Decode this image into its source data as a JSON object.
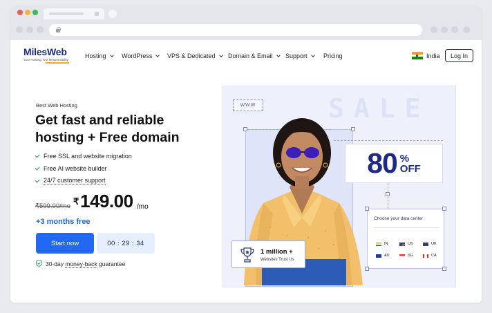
{
  "brand": {
    "name": "MilesWeb",
    "tagline": "Your Hosting, Our Responsibility.",
    "accent": "#2368f2",
    "dark": "#1c2a86"
  },
  "nav": {
    "items": [
      {
        "label": "Hosting",
        "dropdown": true
      },
      {
        "label": "WordPress",
        "dropdown": true
      },
      {
        "label": "VPS & Dedicated",
        "dropdown": true
      },
      {
        "label": "Domain & Email",
        "dropdown": true
      },
      {
        "label": "Support",
        "dropdown": true
      },
      {
        "label": "Pricing",
        "dropdown": false
      }
    ],
    "country": "India",
    "login": "Log In"
  },
  "hero": {
    "kicker": "Best Web Hosting",
    "title_line1": "Get fast and reliable",
    "title_line2": "hosting + Free domain",
    "features": [
      "Free SSL and website migration",
      "Free AI website builder",
      "24/7 customer support"
    ],
    "old_price": "₹599.00/mo",
    "currency": "₹",
    "price": "149.00",
    "per": "/mo",
    "bonus": "+3 months free",
    "cta": "Start now",
    "timer": "00 : 29 : 34",
    "guarantee_prefix": "30-day ",
    "guarantee_link": "money-back",
    "guarantee_suffix": " guarantee"
  },
  "promo": {
    "sale_text": "SALE",
    "www": "WWW",
    "discount": "80",
    "percent": "%",
    "off": "OFF",
    "datacenter_title": "Choose your data center",
    "locations": [
      "IN",
      "US",
      "UK",
      "AU",
      "SG",
      "CA"
    ],
    "trust_big": "1 million +",
    "trust_small": "Websites Trust Us"
  }
}
